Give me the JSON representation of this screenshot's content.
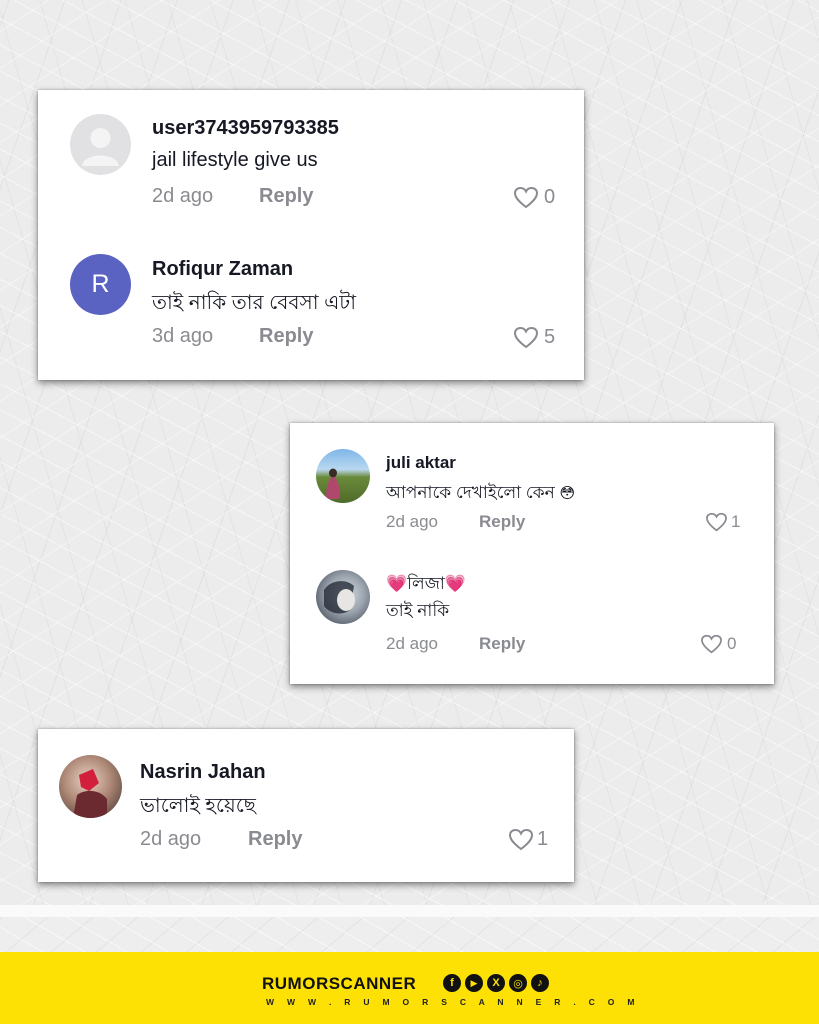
{
  "cards": [
    {
      "comments": [
        {
          "username": "user3743959793385",
          "text": "jail lifestyle give us",
          "time": "2d ago",
          "reply": "Reply",
          "likes": "0"
        },
        {
          "username": "Rofiqur Zaman",
          "avatar_letter": "R",
          "text": "তাই নাকি তার বেবসা এটা",
          "time": "3d ago",
          "reply": "Reply",
          "likes": "5"
        }
      ]
    },
    {
      "comments": [
        {
          "username": "juli aktar",
          "text": "আপনাকে দেখাইলো কেন",
          "emoji": "😳",
          "time": "2d ago",
          "reply": "Reply",
          "likes": "1"
        },
        {
          "username": "লিজা",
          "username_emoji": "💗",
          "text": "তাই নাকি",
          "time": "2d ago",
          "reply": "Reply",
          "likes": "0"
        }
      ]
    },
    {
      "comments": [
        {
          "username": "Nasrin Jahan",
          "text": "ভালোই হয়েছে",
          "time": "2d ago",
          "reply": "Reply",
          "likes": "1"
        }
      ]
    }
  ],
  "footer": {
    "brand": "RUMORSCANNER",
    "url": "W W W . R U M O R S C A N N E R . C O M",
    "social_icons": [
      "facebook-icon",
      "youtube-icon",
      "x-icon",
      "instagram-icon",
      "tiktok-icon"
    ],
    "social_glyphs": [
      "f",
      "▶",
      "X",
      "◎",
      "♪"
    ]
  },
  "colors": {
    "footer_bg": "#fde104",
    "avatar_r": "#5b63c2",
    "muted": "#8a8b91",
    "text": "#161823"
  }
}
